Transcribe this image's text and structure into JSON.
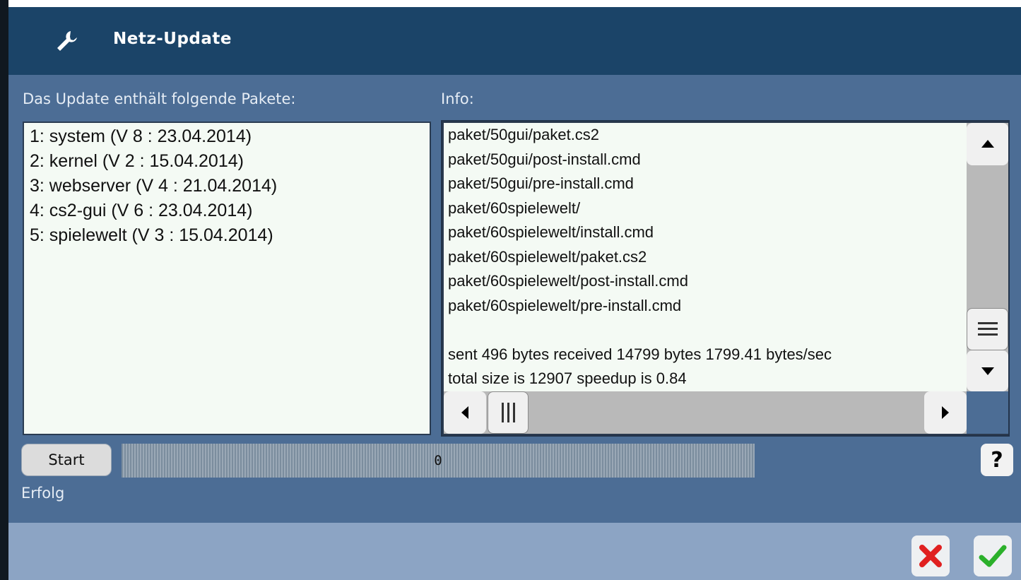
{
  "window": {
    "title": "Netz-Update",
    "icon": "wrench-icon"
  },
  "packages": {
    "label": "Das Update enthält folgende Pakete:",
    "items": [
      "1: system (V 8 : 23.04.2014)",
      "2: kernel (V 2 : 15.04.2014)",
      "3: webserver (V 4 : 21.04.2014)",
      "4: cs2-gui (V 6 : 23.04.2014)",
      "5: spielewelt (V 3 : 15.04.2014)"
    ]
  },
  "info": {
    "label": "Info:",
    "lines": [
      "paket/50gui/paket.cs2",
      "paket/50gui/post-install.cmd",
      "paket/50gui/pre-install.cmd",
      "paket/60spielewelt/",
      "paket/60spielewelt/install.cmd",
      "paket/60spielewelt/paket.cs2",
      "paket/60spielewelt/post-install.cmd",
      "paket/60spielewelt/pre-install.cmd",
      "",
      "sent 496 bytes  received 14799 bytes  1799.41 bytes/sec",
      "total size is 12907  speedup is 0.84"
    ]
  },
  "actions": {
    "start_label": "Start",
    "help_label": "?"
  },
  "progress": {
    "text": "0",
    "value": 0
  },
  "status": {
    "text": "Erfolg"
  },
  "colors": {
    "titlebar": "#1b4468",
    "dialog": "#4c6d95",
    "footer": "#8ca4c4",
    "cancel": "#e02020",
    "ok": "#2bb02b"
  }
}
